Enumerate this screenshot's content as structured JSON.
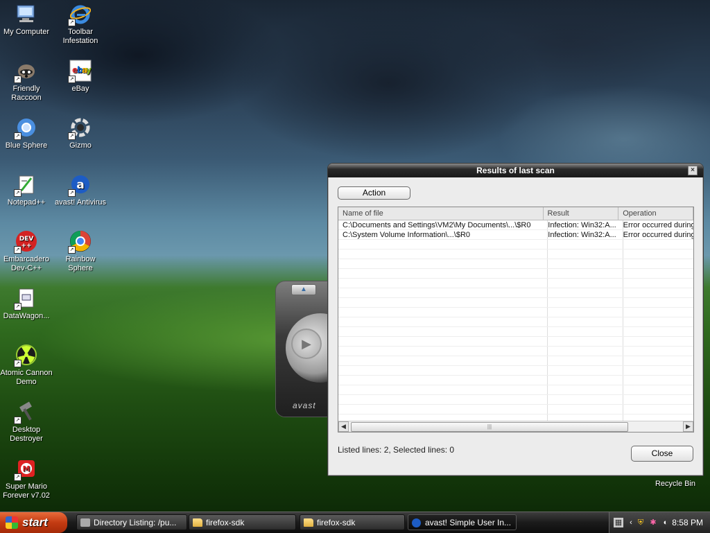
{
  "desktop": {
    "icons": [
      {
        "label": "My Computer",
        "icon": "computer-icon"
      },
      {
        "label": "Toolbar Infestation",
        "icon": "ie-icon"
      },
      {
        "label": "Friendly Raccoon",
        "icon": "raccoon-icon"
      },
      {
        "label": "eBay",
        "icon": "ebay-icon"
      },
      {
        "label": "Blue Sphere",
        "icon": "chromium-icon"
      },
      {
        "label": "Gizmo",
        "icon": "gizmo-icon"
      },
      {
        "label": "Notepad++",
        "icon": "notepadpp-icon"
      },
      {
        "label": "avast! Antivirus",
        "icon": "avast-icon"
      },
      {
        "label": "Embarcadero Dev-C++",
        "icon": "devcpp-icon"
      },
      {
        "label": "Rainbow Sphere",
        "icon": "chrome-icon"
      },
      {
        "label": "DataWagon...",
        "icon": "document-icon"
      },
      {
        "label": "Atomic Cannon Demo",
        "icon": "radiation-icon"
      },
      {
        "label": "Desktop Destroyer",
        "icon": "hammer-icon"
      },
      {
        "label": "Super Mario Forever v7.02",
        "icon": "mario-icon"
      }
    ],
    "recycle_bin": "Recycle Bin"
  },
  "avast_widget": {
    "brand": "avast"
  },
  "dialog": {
    "title": "Results of last scan",
    "action_button": "Action",
    "columns": [
      "Name of file",
      "Result",
      "Operation"
    ],
    "rows": [
      {
        "name": "C:\\Documents and Settings\\VM2\\My Documents\\...\\$R0",
        "result": "Infection: Win32:A...",
        "operation": "Error occurred during"
      },
      {
        "name": "C:\\System Volume Information\\...\\$R0",
        "result": "Infection: Win32:A...",
        "operation": "Error occurred during"
      }
    ],
    "status": "Listed lines: 2,  Selected lines: 0",
    "close_button": "Close"
  },
  "taskbar": {
    "start_label": "start",
    "tasks": [
      {
        "label": "Directory Listing: /pu...",
        "icon": "browser-icon"
      },
      {
        "label": "firefox-sdk",
        "icon": "folder-icon"
      },
      {
        "label": "firefox-sdk",
        "icon": "folder-icon"
      },
      {
        "label": "avast! Simple User In...",
        "icon": "avast-icon"
      }
    ],
    "clock": "8:58 PM"
  }
}
